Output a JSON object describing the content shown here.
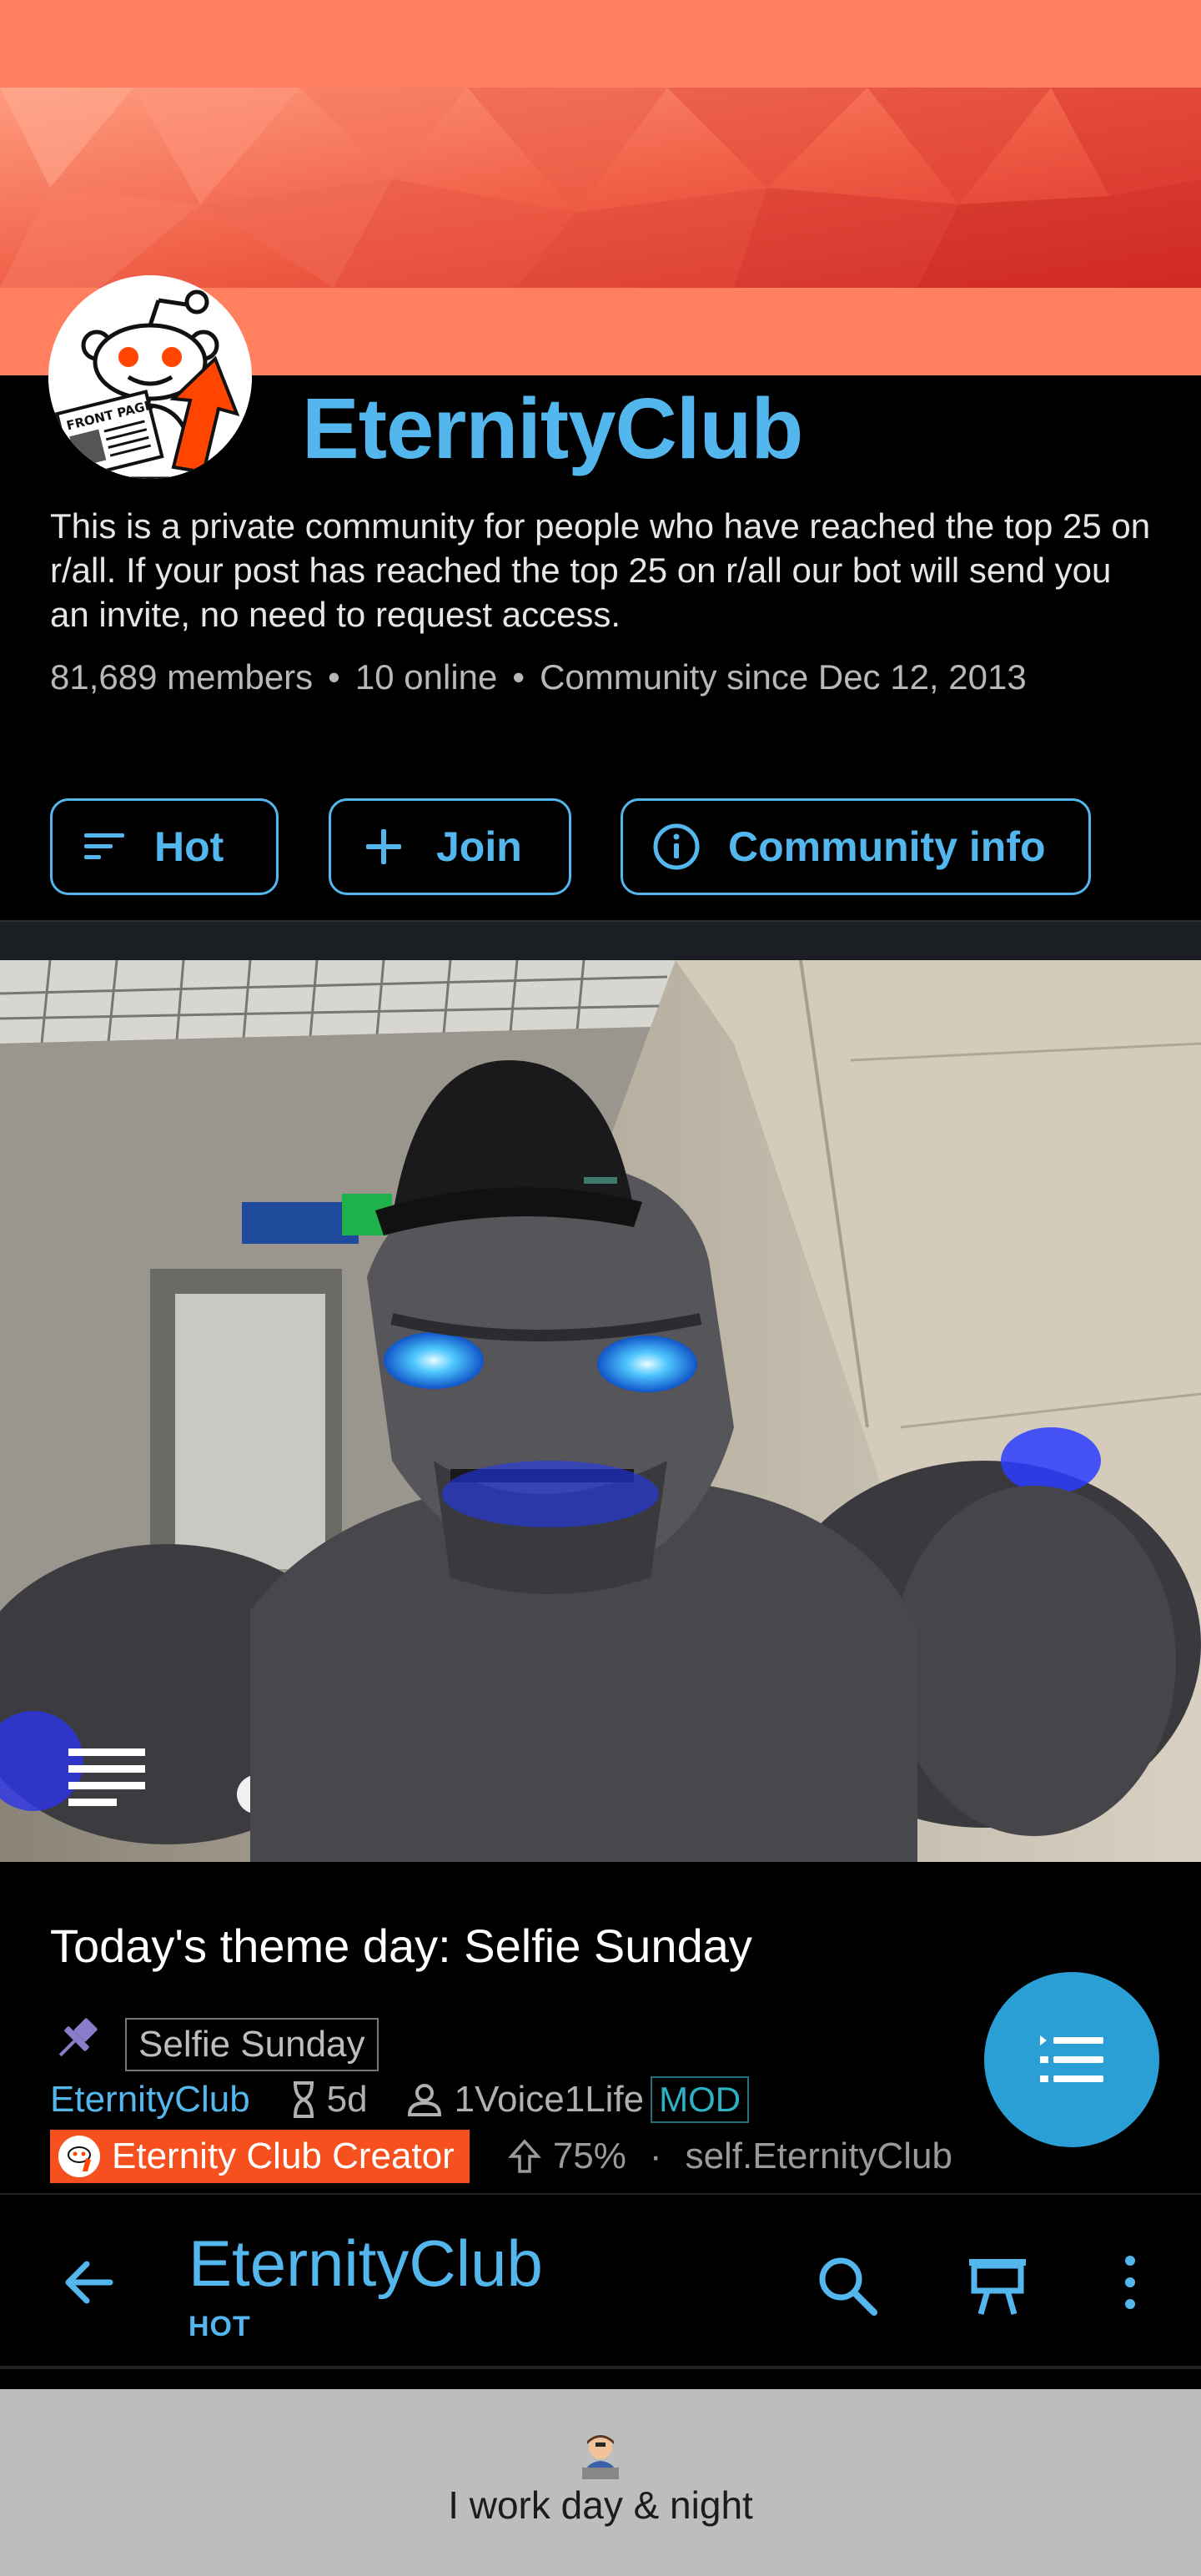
{
  "community": {
    "name": "EternityClub",
    "description": "This is a private community for people who have reached the top 25 on r/all. If your post has reached the top 25 on r/all our bot will send you an invite, no need to request access.",
    "members": "81,689 members",
    "online": "10 online",
    "since": "Community since Dec 12, 2013",
    "separator": "•",
    "avatar_text": "FRONT PAGE"
  },
  "actions": {
    "hot_label": "Hot",
    "join_label": "Join",
    "info_label": "Community info"
  },
  "post": {
    "title": "Today's theme day: Selfie Sunday",
    "flair": "Selfie Sunday",
    "subreddit": "EternityClub",
    "age": "5d",
    "author": "1Voice1Life",
    "mod_badge": "MOD",
    "author_flair": "Eternity Club Creator",
    "upvote_ratio": "75%",
    "meta_separator": "·",
    "domain": "self.EternityClub"
  },
  "toolbar": {
    "title": "EternityClub",
    "sort": "HOT"
  },
  "bottom_card": {
    "text": "I work day & night"
  },
  "colors": {
    "accent": "#53b7ee",
    "banner": "#ff7f5f",
    "fab": "#2a9fd6",
    "flair_red": "#f5501e",
    "mod_teal": "#2db1c4"
  },
  "icons": [
    "sort-lines-icon",
    "plus-icon",
    "info-icon",
    "text-post-icon",
    "pin-icon",
    "hourglass-icon",
    "person-icon",
    "upvote-arrow-icon",
    "list-fab-icon",
    "back-arrow-icon",
    "search-icon",
    "display-mode-icon",
    "more-vertical-icon",
    "worker-emoji-icon"
  ]
}
